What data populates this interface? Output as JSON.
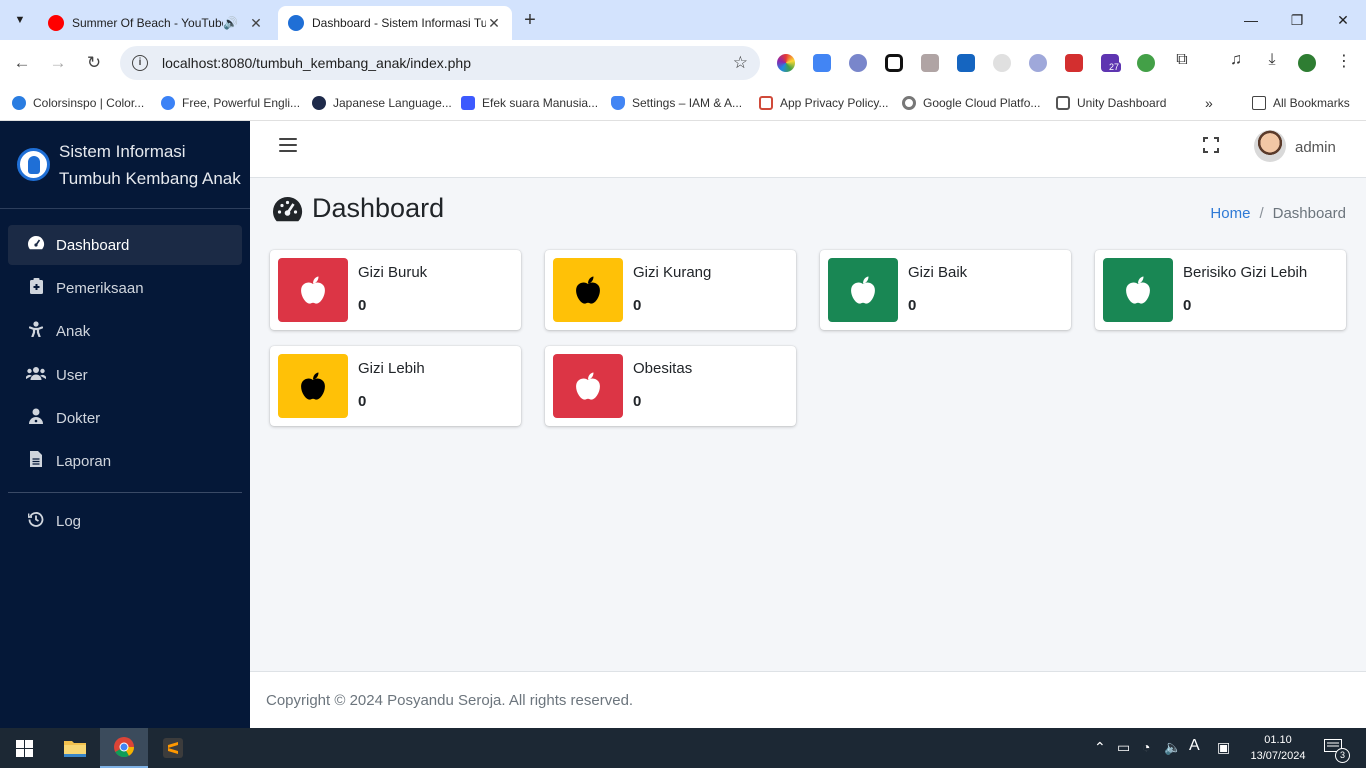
{
  "browser": {
    "tabs": [
      {
        "title": "Summer Of Beach - YouTube",
        "active": false,
        "favicon_color": "#ff0000"
      },
      {
        "title": "Dashboard - Sistem Informasi Tumbuh Kembang Anak",
        "active": true,
        "favicon_color": "#1f6fd6"
      }
    ],
    "url": "localhost:8080/tumbuh_kembang_anak/index.php",
    "extension_badge": "27",
    "bookmarks": [
      {
        "label": "Colorsinspo | Color...",
        "color": "#2a7de1"
      },
      {
        "label": "Free, Powerful Engli...",
        "color": "#3b82f6"
      },
      {
        "label": "Japanese Language...",
        "color": "#1e2a4a"
      },
      {
        "label": "Efek suara Manusia...",
        "color": "#3d5afe"
      },
      {
        "label": "Settings – IAM & A...",
        "color": "#4285f4"
      },
      {
        "label": "App Privacy Policy...",
        "color": "#d04a3a"
      },
      {
        "label": "Google Cloud Platfo...",
        "color": "#777777"
      },
      {
        "label": "Unity Dashboard",
        "color": "#555555"
      }
    ],
    "all_bookmarks": "All Bookmarks"
  },
  "sidebar": {
    "brand_line1": "Sistem Informasi",
    "brand_line2": "Tumbuh Kembang Anak",
    "items": [
      {
        "label": "Dashboard",
        "icon": "tachometer-icon",
        "active": true
      },
      {
        "label": "Pemeriksaan",
        "icon": "clipboard-medical-icon",
        "active": false
      },
      {
        "label": "Anak",
        "icon": "child-icon",
        "active": false
      },
      {
        "label": "User",
        "icon": "users-icon",
        "active": false
      },
      {
        "label": "Dokter",
        "icon": "doctor-icon",
        "active": false
      },
      {
        "label": "Laporan",
        "icon": "file-icon",
        "active": false
      },
      {
        "label": "Log",
        "icon": "history-icon",
        "active": false
      }
    ]
  },
  "topnav": {
    "username": "admin"
  },
  "page": {
    "title": "Dashboard",
    "breadcrumb": {
      "home": "Home",
      "separator": "/",
      "current": "Dashboard"
    }
  },
  "cards": [
    {
      "label": "Gizi Buruk",
      "count": "0",
      "color": "#dc3545",
      "icon_color": "#ffffff"
    },
    {
      "label": "Gizi Kurang",
      "count": "0",
      "color": "#ffc107",
      "icon_color": "#000000"
    },
    {
      "label": "Gizi Baik",
      "count": "0",
      "color": "#198754",
      "icon_color": "#ffffff"
    },
    {
      "label": "Berisiko Gizi Lebih",
      "count": "0",
      "color": "#198754",
      "icon_color": "#ffffff"
    },
    {
      "label": "Gizi Lebih",
      "count": "0",
      "color": "#ffc107",
      "icon_color": "#000000"
    },
    {
      "label": "Obesitas",
      "count": "0",
      "color": "#dc3545",
      "icon_color": "#ffffff"
    }
  ],
  "footer": {
    "text": "Copyright © 2024 Posyandu Seroja. All rights reserved."
  },
  "taskbar": {
    "time": "01.10",
    "date": "13/07/2024",
    "notification_count": "3",
    "input_indicator": "A"
  }
}
